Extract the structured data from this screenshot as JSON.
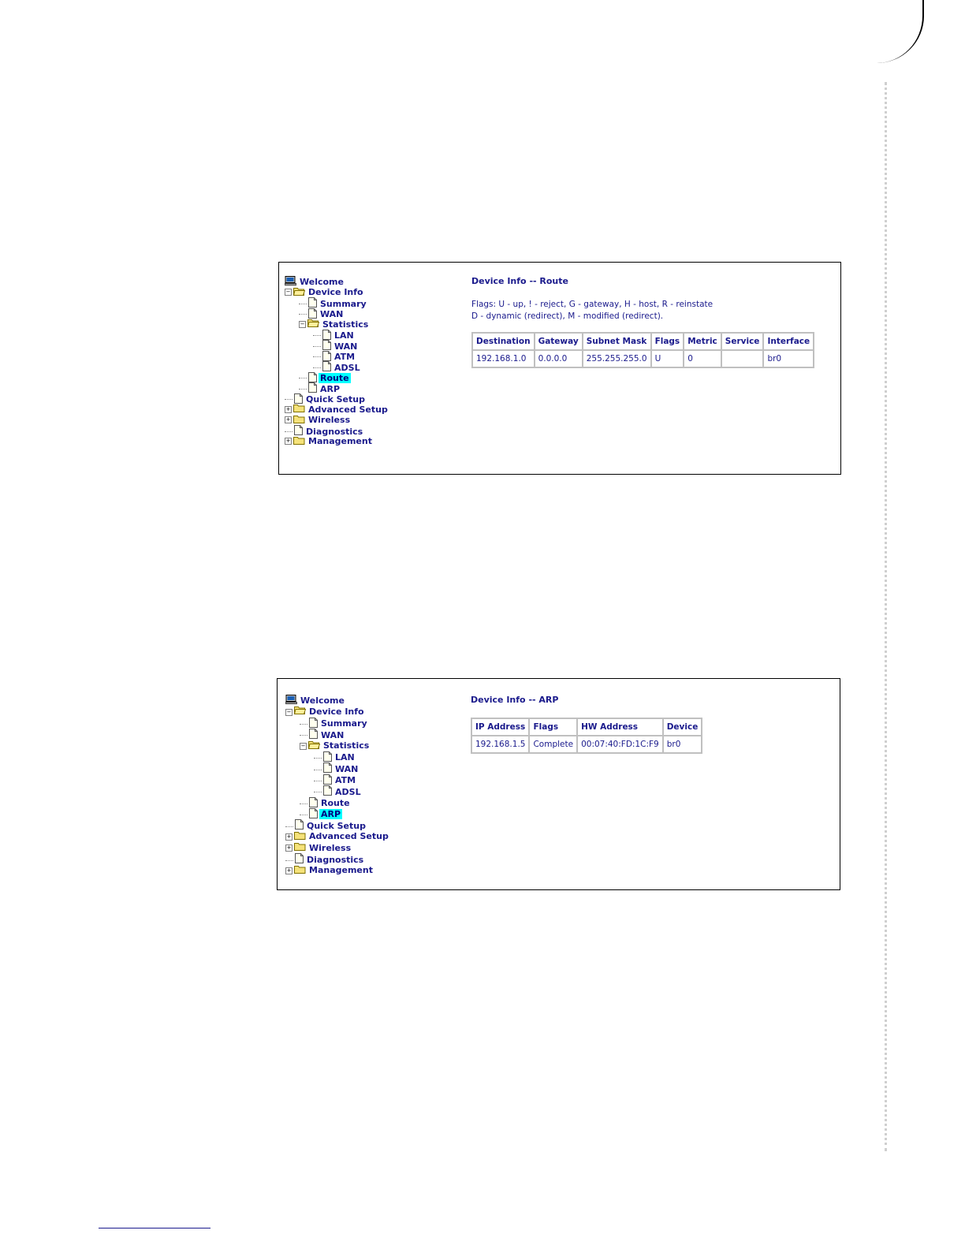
{
  "route_screen": {
    "tree": [
      {
        "label": "Welcome",
        "icon": "computer-icon",
        "depth": 0
      },
      {
        "label": "Device Info",
        "icon": "folder-open-icon",
        "toggle": "-",
        "depth": 0
      },
      {
        "label": "Summary",
        "icon": "page-icon",
        "depth": 1
      },
      {
        "label": "WAN",
        "icon": "page-icon",
        "depth": 1
      },
      {
        "label": "Statistics",
        "icon": "folder-open-icon",
        "toggle": "-",
        "depth": 1
      },
      {
        "label": "LAN",
        "icon": "page-icon",
        "depth": 2
      },
      {
        "label": "WAN",
        "icon": "page-icon",
        "depth": 2
      },
      {
        "label": "ATM",
        "icon": "page-icon",
        "depth": 2
      },
      {
        "label": "ADSL",
        "icon": "page-icon",
        "depth": 2
      },
      {
        "label": "Route",
        "icon": "page-icon",
        "depth": 1,
        "selected": true
      },
      {
        "label": "ARP",
        "icon": "page-icon",
        "depth": 1
      },
      {
        "label": "Quick Setup",
        "icon": "page-icon",
        "depth": 0
      },
      {
        "label": "Advanced Setup",
        "icon": "folder-icon",
        "toggle": "+",
        "depth": 0
      },
      {
        "label": "Wireless",
        "icon": "folder-icon",
        "toggle": "+",
        "depth": 0
      },
      {
        "label": "Diagnostics",
        "icon": "page-icon",
        "depth": 0
      },
      {
        "label": "Management",
        "icon": "folder-icon",
        "toggle": "+",
        "depth": 0
      }
    ],
    "title": "Device Info -- Route",
    "flags_line1": "Flags: U - up, ! - reject, G - gateway, H - host, R - reinstate",
    "flags_line2": "D - dynamic (redirect), M - modified (redirect).",
    "table": {
      "headers": [
        "Destination",
        "Gateway",
        "Subnet Mask",
        "Flags",
        "Metric",
        "Service",
        "Interface"
      ],
      "rows": [
        [
          "192.168.1.0",
          "0.0.0.0",
          "255.255.255.0",
          "U",
          "0",
          "",
          "br0"
        ]
      ]
    }
  },
  "arp_screen": {
    "tree": [
      {
        "label": "Welcome",
        "icon": "computer-icon",
        "depth": 0
      },
      {
        "label": "Device Info",
        "icon": "folder-open-icon",
        "toggle": "-",
        "depth": 0
      },
      {
        "label": "Summary",
        "icon": "page-icon",
        "depth": 1
      },
      {
        "label": "WAN",
        "icon": "page-icon",
        "depth": 1
      },
      {
        "label": "Statistics",
        "icon": "folder-open-icon",
        "toggle": "-",
        "depth": 1
      },
      {
        "label": "LAN",
        "icon": "page-icon",
        "depth": 2
      },
      {
        "label": "WAN",
        "icon": "page-icon",
        "depth": 2
      },
      {
        "label": "ATM",
        "icon": "page-icon",
        "depth": 2
      },
      {
        "label": "ADSL",
        "icon": "page-icon",
        "depth": 2
      },
      {
        "label": "Route",
        "icon": "page-icon",
        "depth": 1
      },
      {
        "label": "ARP",
        "icon": "page-icon",
        "depth": 1,
        "selected": true
      },
      {
        "label": "Quick Setup",
        "icon": "page-icon",
        "depth": 0
      },
      {
        "label": "Advanced Setup",
        "icon": "folder-icon",
        "toggle": "+",
        "depth": 0
      },
      {
        "label": "Wireless",
        "icon": "folder-icon",
        "toggle": "+",
        "depth": 0
      },
      {
        "label": "Diagnostics",
        "icon": "page-icon",
        "depth": 0
      },
      {
        "label": "Management",
        "icon": "folder-icon",
        "toggle": "+",
        "depth": 0
      }
    ],
    "title": "Device Info -- ARP",
    "table": {
      "headers": [
        "IP Address",
        "Flags",
        "HW Address",
        "Device"
      ],
      "rows": [
        [
          "192.168.1.5",
          "Complete",
          "00:07:40:FD:1C:F9",
          "br0"
        ]
      ]
    }
  },
  "colors": {
    "link_text": "#1a1a8c",
    "selection_highlight": "#00ffff",
    "table_border": "#c0c0c0"
  }
}
